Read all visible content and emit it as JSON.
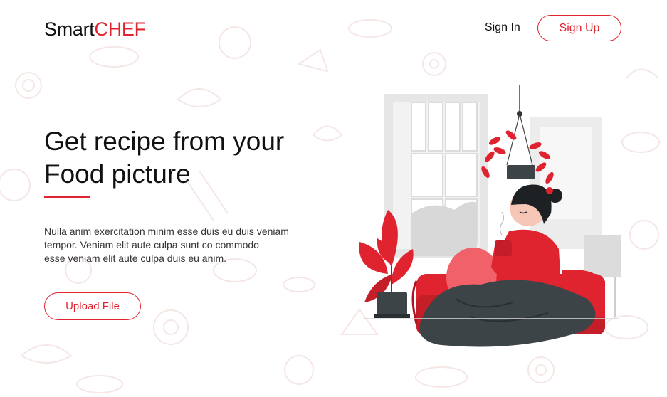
{
  "header": {
    "logo_part1": "Smart",
    "logo_part2": "CHEF",
    "signin_label": "Sign In",
    "signup_label": "Sign Up"
  },
  "hero": {
    "title_line1": "Get recipe from your",
    "title_line2": "Food picture",
    "desc_line1": "Nulla anim exercitation minim esse duis eu duis veniam",
    "desc_line2": "tempor. Veniam elit aute culpa sunt co commodo",
    "desc_line3": "esse veniam elit aute culpa duis eu anim.",
    "upload_label": "Upload File"
  },
  "colors": {
    "accent": "#e0242f",
    "text": "#111111",
    "pattern": "#f4e7e5"
  },
  "illustration": {
    "icons": [
      "window-icon",
      "hanging-plant-icon",
      "potted-plant-icon",
      "sofa-icon",
      "woman-with-cup-icon",
      "blanket-icon"
    ]
  }
}
